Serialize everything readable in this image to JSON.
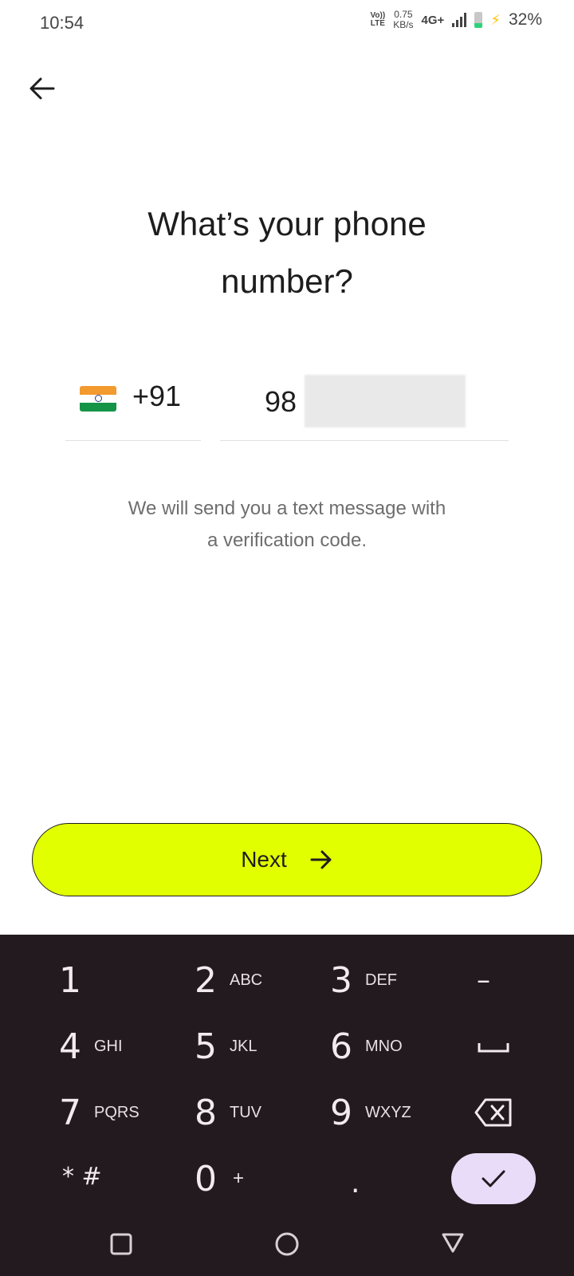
{
  "status_bar": {
    "time": "10:54",
    "volte_top": "Vo))",
    "volte_bottom": "LTE",
    "speed_value": "0.75",
    "speed_unit": "KB/s",
    "network": "4G+",
    "battery_percent": "32%",
    "battery_level": 0.32
  },
  "screen": {
    "title_line1": "What’s your phone",
    "title_line2": "number?",
    "country_code": "+91",
    "country_flag": "india-flag-icon",
    "phone_prefix": "98",
    "info_line1": "We will send you a text message with",
    "info_line2": "a verification code.",
    "next_label": "Next"
  },
  "keyboard": {
    "keys": [
      {
        "digit": "1",
        "letters": ""
      },
      {
        "digit": "2",
        "letters": "ABC"
      },
      {
        "digit": "3",
        "letters": "DEF"
      },
      {
        "digit": "4",
        "letters": "GHI"
      },
      {
        "digit": "5",
        "letters": "JKL"
      },
      {
        "digit": "6",
        "letters": "MNO"
      },
      {
        "digit": "7",
        "letters": "PQRS"
      },
      {
        "digit": "8",
        "letters": "TUV"
      },
      {
        "digit": "9",
        "letters": "WXYZ"
      },
      {
        "digit": "* #",
        "letters": ""
      },
      {
        "digit": "0",
        "letters": "+"
      },
      {
        "digit": ".",
        "letters": ""
      }
    ],
    "minus_key": "–",
    "colors": {
      "background": "#231a1f",
      "done_key": "#e9dcf8"
    }
  },
  "colors": {
    "accent": "#e2ff00",
    "text": "#1d1d1d",
    "muted": "#6e6e6e"
  }
}
